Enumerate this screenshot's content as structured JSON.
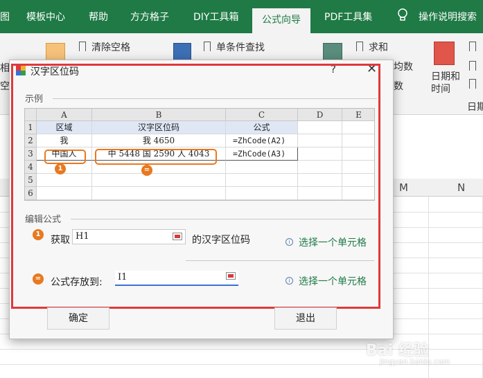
{
  "ribbon": {
    "tabs": [
      {
        "label": "图"
      },
      {
        "label": "模板中心"
      },
      {
        "label": "帮助"
      },
      {
        "label": "方方格子"
      },
      {
        "label": "DIY工具箱"
      },
      {
        "label": "公式向导",
        "active": true
      },
      {
        "label": "PDF工具集"
      },
      {
        "label": "操作说明搜索"
      }
    ],
    "commands": {
      "clear_spaces": "清除空格",
      "single_condition_find": "单条件查找",
      "sum": "求和",
      "avg": "均数",
      "count": "数",
      "date_time": "日期和\n时间",
      "date_time_line1": "日期和",
      "date_time_line2": "时间",
      "date_group": "日期",
      "left_frag1": "相",
      "left_frag2": "空"
    }
  },
  "sheet": {
    "columns": [
      "M",
      "N"
    ]
  },
  "dialog": {
    "title": "汉字区位码",
    "help": "?",
    "close": "✕",
    "example_section": "示例",
    "edit_section": "编辑公式",
    "sample": {
      "col_headers": [
        "A",
        "B",
        "C",
        "D",
        "E"
      ],
      "row_numbers": [
        "1",
        "2",
        "3",
        "4",
        "5",
        "6"
      ],
      "rows": [
        [
          "区域",
          "汉字区位码",
          "公式",
          "",
          ""
        ],
        [
          "我",
          "我 4650",
          "=ZhCode(A2)",
          "",
          ""
        ],
        [
          "中国人",
          "中 5448 国 2590 人 4043",
          "=ZhCode(A3)",
          "",
          ""
        ]
      ],
      "badges": [
        "1",
        "="
      ]
    },
    "get": {
      "prefix": "获取",
      "value": "H1",
      "suffix": "的汉字区位码",
      "hint": "选择一个单元格",
      "badge": "1"
    },
    "store": {
      "label": "公式存放到:",
      "value": "I1",
      "hint": "选择一个单元格",
      "badge": "="
    },
    "ok": "确定",
    "cancel": "退出"
  },
  "watermark": {
    "brand": "Bai 经验",
    "url": "jingyan.baidu.com"
  },
  "colors": {
    "ribbon_green": "#1f7a45",
    "red_frame": "#e0393b",
    "orange": "#e8791f",
    "hint_green": "#1f7a45"
  }
}
